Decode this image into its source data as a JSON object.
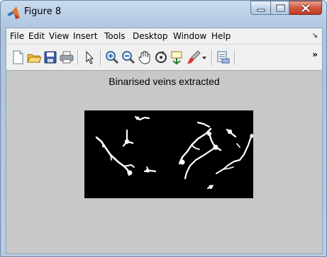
{
  "window": {
    "title": "Figure 8"
  },
  "menu": {
    "items": [
      "File",
      "Edit",
      "View",
      "Insert",
      "Tools",
      "Desktop",
      "Window",
      "Help"
    ],
    "overflow_glyph": "↘"
  },
  "toolbar": {
    "buttons": [
      "new-figure-icon",
      "open-file-icon",
      "save-icon",
      "print-icon",
      "edit-plot-pointer-icon",
      "zoom-in-icon",
      "zoom-out-icon",
      "pan-hand-icon",
      "rotate-3d-icon",
      "data-cursor-icon",
      "brush-icon",
      "brush-dropdown-icon",
      "link-plot-icon"
    ],
    "overflow_label": "»"
  },
  "figure": {
    "plot_title": "Binarised veins extracted"
  },
  "colors": {
    "figure_bg": "#c8c8c8",
    "axes_bg": "#000000",
    "vein": "#ffffff",
    "close_button": "#c94428",
    "title_bar": "#b9cfe8"
  }
}
